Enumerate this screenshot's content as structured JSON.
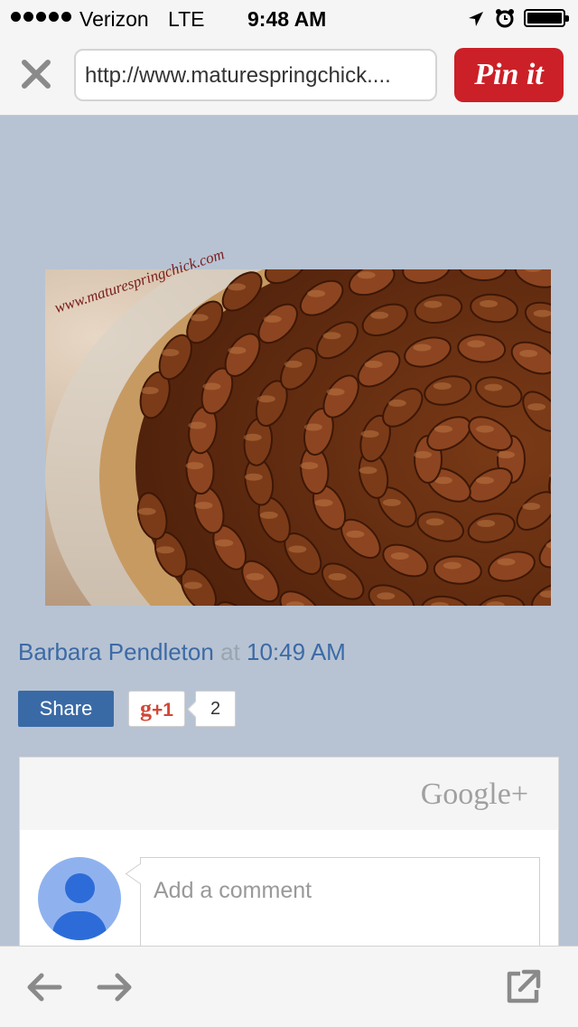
{
  "status_bar": {
    "carrier": "Verizon",
    "network": "LTE",
    "time": "9:48 AM"
  },
  "browser": {
    "url": "http://www.maturespringchick....",
    "pin_label": "Pin it"
  },
  "post": {
    "photo_watermark": "www.maturespringchick.com",
    "author": "Barbara Pendleton",
    "at_word": "at",
    "time": "10:49 AM",
    "share_label": "Share",
    "gplus_label_g": "g",
    "gplus_label_one": "+1",
    "gplus_count": "2"
  },
  "comments": {
    "brand": "Google+",
    "placeholder": "Add a comment"
  },
  "colors": {
    "page_bg": "#b7c3d3",
    "link_blue": "#3c6aa6",
    "pinterest_red": "#cb2027"
  },
  "icons": [
    "close-icon",
    "back-arrow-icon",
    "forward-arrow-icon",
    "share-out-icon",
    "location-arrow-icon",
    "alarm-icon",
    "battery-icon"
  ]
}
